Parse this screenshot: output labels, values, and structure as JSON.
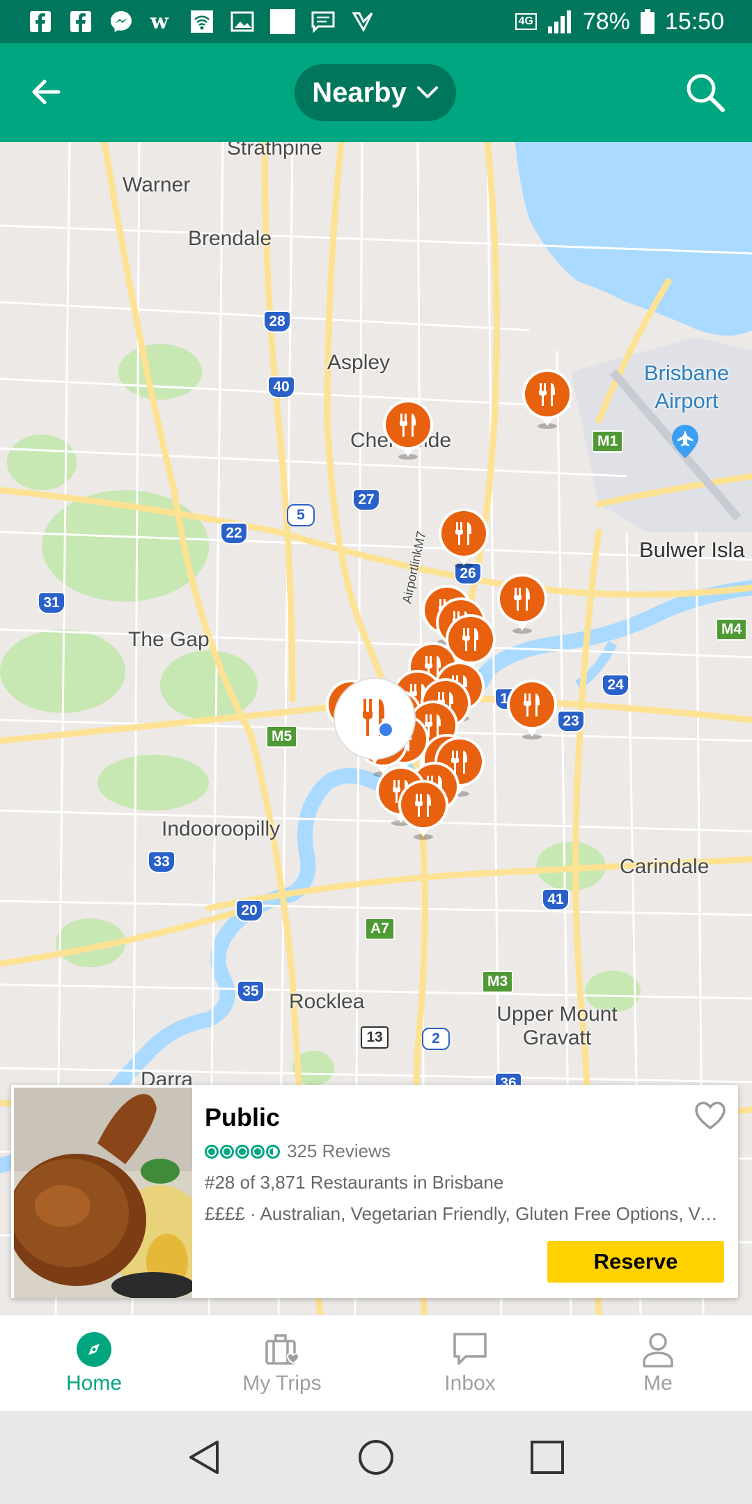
{
  "status_bar": {
    "network": "4G",
    "battery": "78%",
    "time": "15:50",
    "left_icons": [
      "facebook-icon",
      "facebook-icon",
      "messenger-icon",
      "app-w-icon",
      "wifi-hotspot-icon",
      "gallery-icon",
      "blank-app-icon",
      "message-icon",
      "check-icon"
    ]
  },
  "header": {
    "title": "Nearby",
    "back_icon": "arrow-left-icon",
    "search_icon": "search-icon"
  },
  "map": {
    "labels": [
      {
        "id": "strathpine",
        "text": "Strathpine"
      },
      {
        "id": "warner",
        "text": "Warner"
      },
      {
        "id": "brendale",
        "text": "Brendale"
      },
      {
        "id": "aspley",
        "text": "Aspley"
      },
      {
        "id": "chermside",
        "text": "Chermside"
      },
      {
        "id": "brisbane-airport",
        "text": "Brisbane Airport"
      },
      {
        "id": "bulwer-island",
        "text": "Bulwer Isla"
      },
      {
        "id": "the-gap",
        "text": "The Gap"
      },
      {
        "id": "indooroopilly",
        "text": "Indooroopilly"
      },
      {
        "id": "carindale",
        "text": "Carindale"
      },
      {
        "id": "rocklea",
        "text": "Rocklea"
      },
      {
        "id": "upper-mount-gravatt",
        "text": "Upper Mount Gravatt"
      },
      {
        "id": "darra",
        "text": "Darra"
      },
      {
        "id": "airportlinkm7",
        "text": "AirportlinkM7"
      }
    ],
    "road_shields": [
      "28",
      "40",
      "27",
      "5",
      "22",
      "26",
      "31",
      "10",
      "23",
      "24",
      "M1",
      "M4",
      "M5",
      "33",
      "20",
      "A7",
      "41",
      "35",
      "M3",
      "13",
      "2",
      "36"
    ],
    "pin_count": 22,
    "accent_color": "#e8610f"
  },
  "card": {
    "name": "Public",
    "rating": 4.5,
    "reviews": "325 Reviews",
    "rank": "#28 of 3,871 Restaurants in Brisbane",
    "details": "££££ · Australian, Vegetarian Friendly, Gluten Free Options, Veg...",
    "reserve_label": "Reserve",
    "heart_icon": "heart-outline-icon"
  },
  "nav": {
    "items": [
      {
        "label": "Home",
        "icon": "compass-icon",
        "active": true
      },
      {
        "label": "My Trips",
        "icon": "suitcase-heart-icon",
        "active": false
      },
      {
        "label": "Inbox",
        "icon": "chat-bubble-icon",
        "active": false
      },
      {
        "label": "Me",
        "icon": "person-icon",
        "active": false
      }
    ]
  },
  "colors": {
    "header_green": "#00a680",
    "status_green": "#00775c",
    "reserve_yellow": "#ffd200",
    "pin_orange": "#e8610f"
  }
}
